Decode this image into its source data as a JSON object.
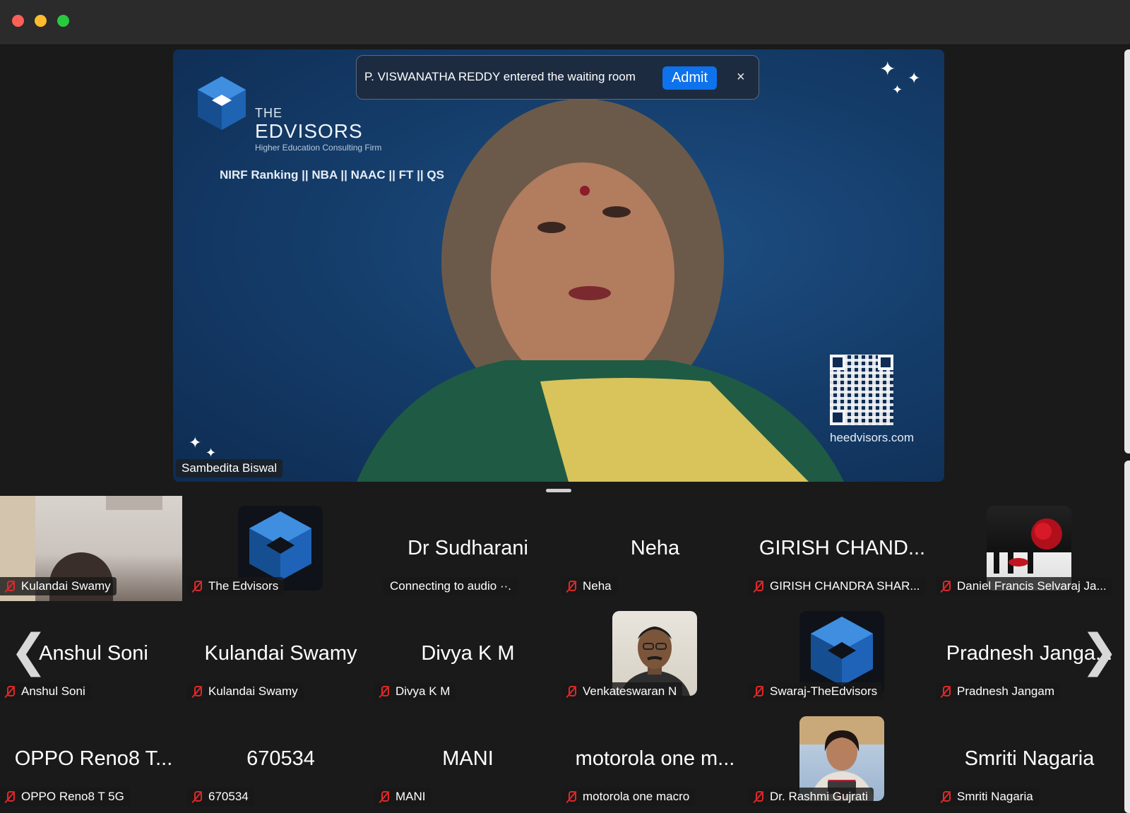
{
  "window": {
    "controls": [
      "close",
      "minimize",
      "zoom"
    ]
  },
  "main_video": {
    "speaker_name": "Sambedita Biswal",
    "background": {
      "brand_the": "THE",
      "brand_name": "EDVISORS",
      "brand_tagline": "Higher Education Consulting Firm",
      "rankings": "NIRF Ranking || NBA || NAAC || FT || QS",
      "website": "heedvisors.com"
    }
  },
  "notification": {
    "message": "P. VISWANATHA REDDY entered the waiting room",
    "admit_label": "Admit",
    "close_glyph": "×"
  },
  "gallery": {
    "prev_glyph": "❮",
    "next_glyph": "❯",
    "tiles": [
      {
        "display": "",
        "label": "Kulandai Swamy",
        "type": "camera"
      },
      {
        "display": "",
        "label": "The Edvisors",
        "type": "logo"
      },
      {
        "display": "Dr Sudharani",
        "status": "Connecting to audio ··."
      },
      {
        "display": "Neha",
        "label": "Neha"
      },
      {
        "display": "GIRISH CHAND...",
        "label": "GIRISH CHANDRA SHAR..."
      },
      {
        "display": "",
        "label": "Daniel Francis Selvaraj Ja...",
        "type": "rose"
      },
      {
        "display": "Anshul Soni",
        "label": "Anshul Soni"
      },
      {
        "display": "Kulandai Swamy",
        "label": "Kulandai Swamy"
      },
      {
        "display": "Divya K M",
        "label": "Divya K M"
      },
      {
        "display": "",
        "label": "Venkateswaran N",
        "type": "photo-man"
      },
      {
        "display": "",
        "label": "Swaraj-TheEdvisors",
        "type": "logo"
      },
      {
        "display": "Pradnesh Janga...",
        "label": "Pradnesh Jangam"
      },
      {
        "display": "OPPO Reno8 T...",
        "label": "OPPO Reno8 T 5G"
      },
      {
        "display": "670534",
        "label": "670534"
      },
      {
        "display": "MANI",
        "label": "MANI"
      },
      {
        "display": "motorola one m...",
        "label": "motorola one macro"
      },
      {
        "display": "",
        "label": "Dr. Rashmi Gujrati",
        "type": "photo-woman"
      },
      {
        "display": "Smriti Nagaria",
        "label": "Smriti Nagaria"
      }
    ]
  },
  "colors": {
    "accent": "#0e72ed",
    "muted_mic": "#e02828",
    "bg": "#1a1a1a"
  }
}
